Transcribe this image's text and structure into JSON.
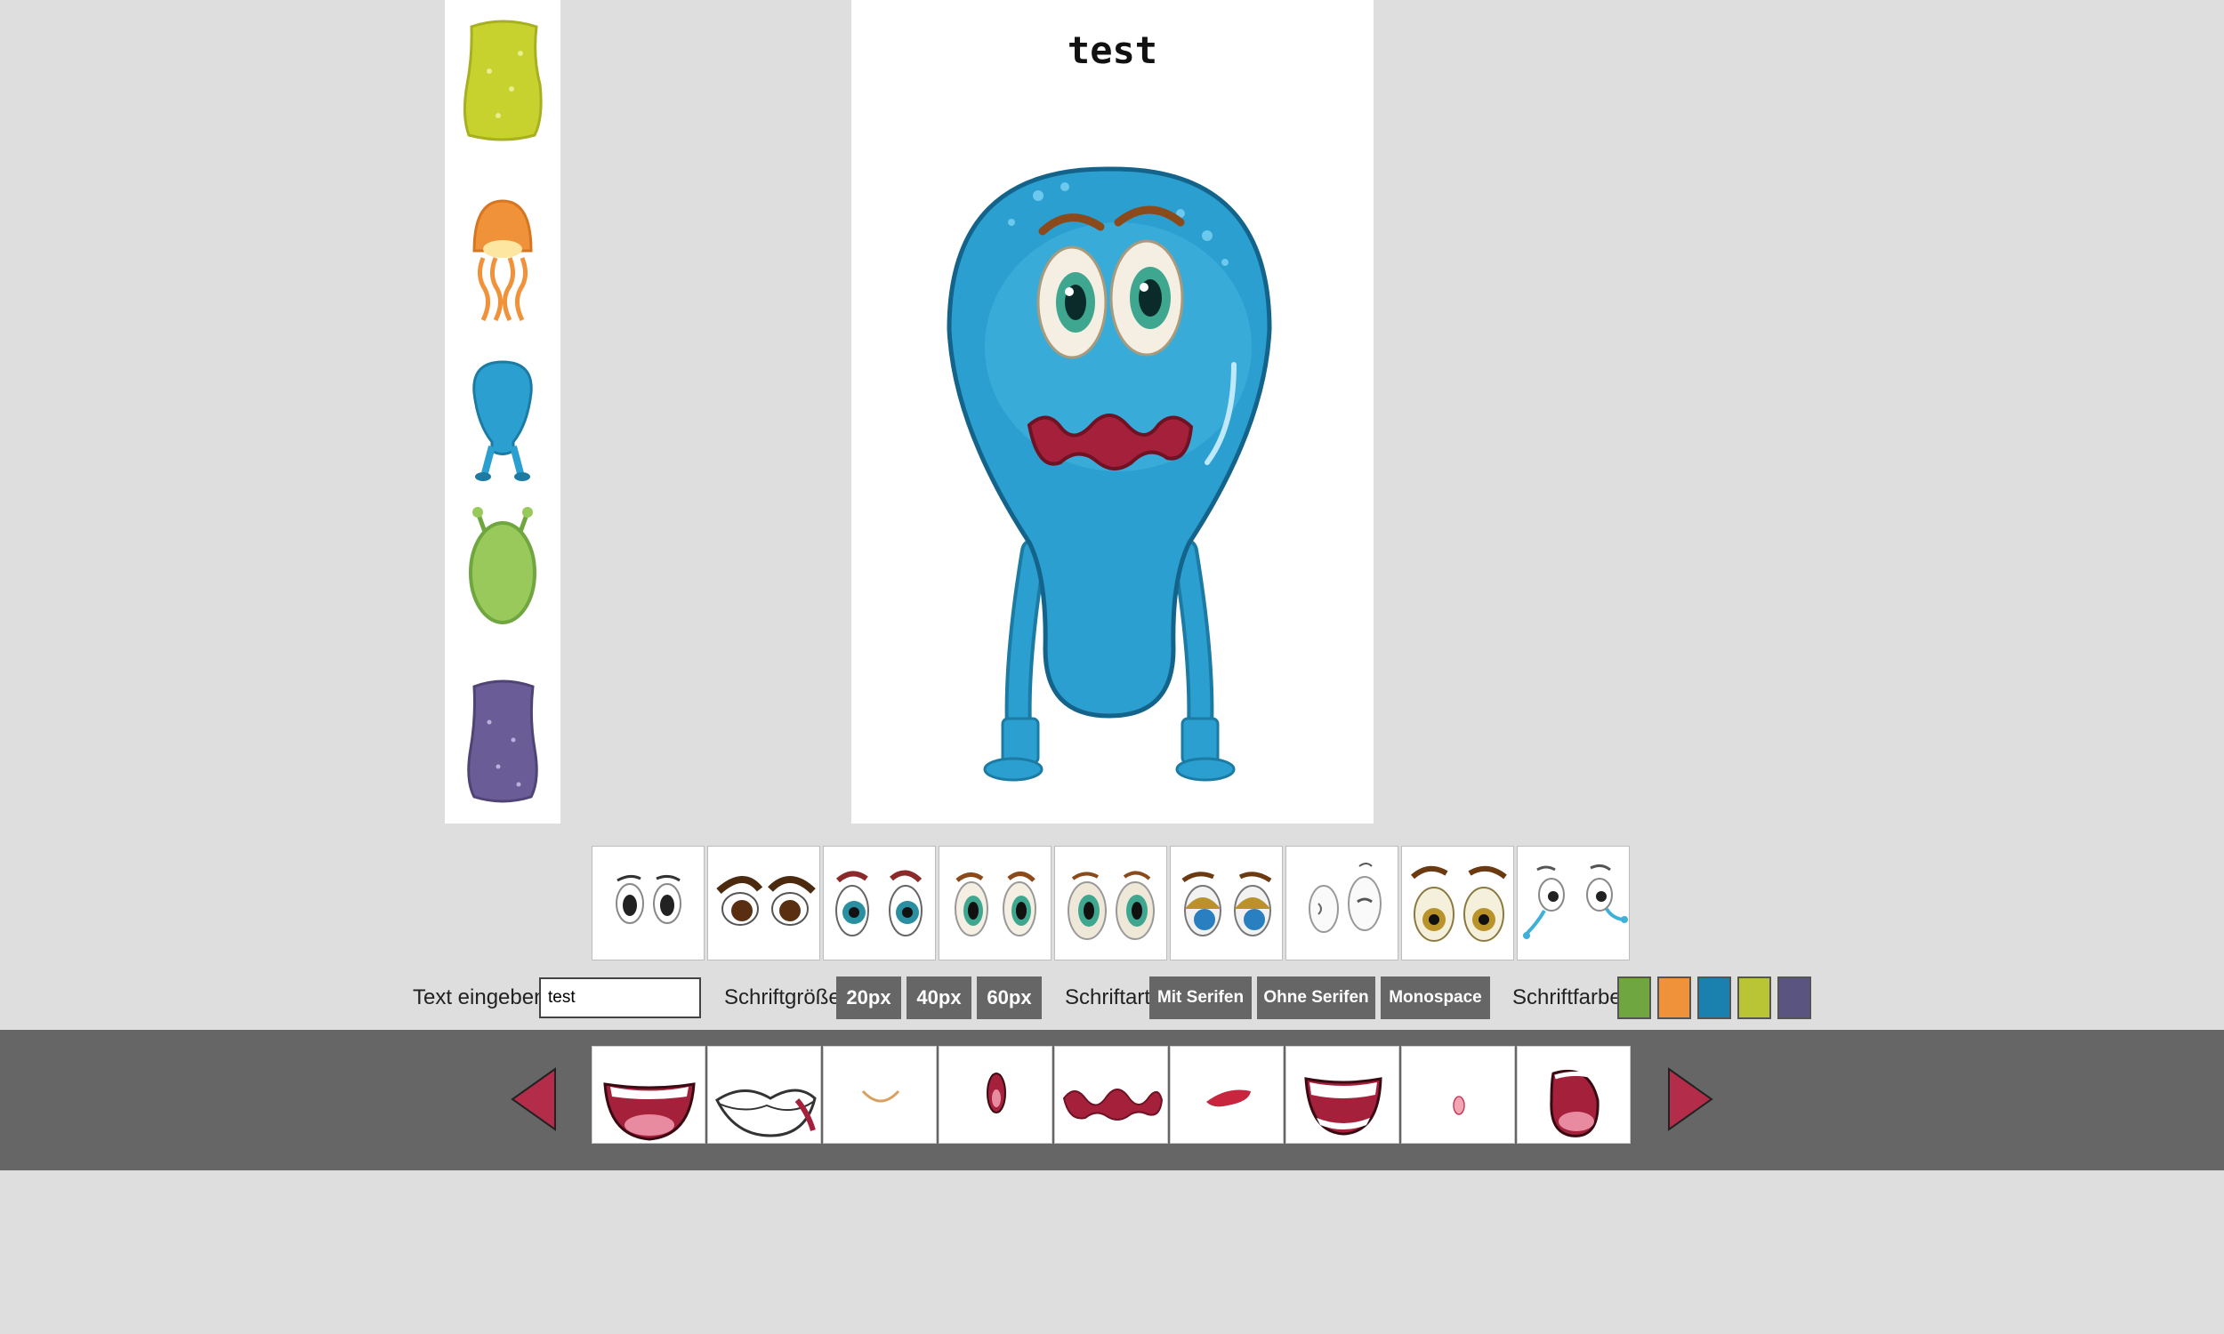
{
  "canvas": {
    "text": "test"
  },
  "body_options": [
    {
      "name": "yellow-blob-body",
      "color": "#c8d22e"
    },
    {
      "name": "orange-jellyfish-body",
      "color": "#f0923a"
    },
    {
      "name": "blue-longlegs-body",
      "color": "#2a9fd0"
    },
    {
      "name": "green-antenna-body",
      "color": "#98c95a"
    },
    {
      "name": "purple-blob-body",
      "color": "#6a5c96"
    }
  ],
  "eye_options": [
    "eyes-plain",
    "eyes-angry-brown",
    "eyes-teal-browed",
    "eyes-green",
    "eyes-green-round",
    "eyes-sleepy",
    "eyes-winking",
    "eyes-golden-browed",
    "eyes-crying"
  ],
  "mouth_options": [
    "mouth-laugh",
    "mouth-grimace",
    "mouth-smile-small",
    "mouth-oval-open",
    "mouth-wavy",
    "mouth-small-frown",
    "mouth-grin",
    "mouth-tiny-o",
    "mouth-round-open"
  ],
  "controls": {
    "text_label": "Text eingeben:",
    "text_value": "test",
    "size_label": "Schriftgröße:",
    "sizes": [
      "20px",
      "40px",
      "60px"
    ],
    "font_label": "Schriftart:",
    "fonts": [
      "Mit Serifen",
      "Ohne Serifen",
      "Monospace"
    ],
    "color_label": "Schriftfarbe:",
    "colors": [
      "#6fa63f",
      "#f0923a",
      "#1a80ad",
      "#b9c535",
      "#5a5480"
    ]
  },
  "nav": {
    "prev_icon": "arrow-left-icon",
    "next_icon": "arrow-right-icon",
    "arrow_color": "#b32d4a"
  }
}
